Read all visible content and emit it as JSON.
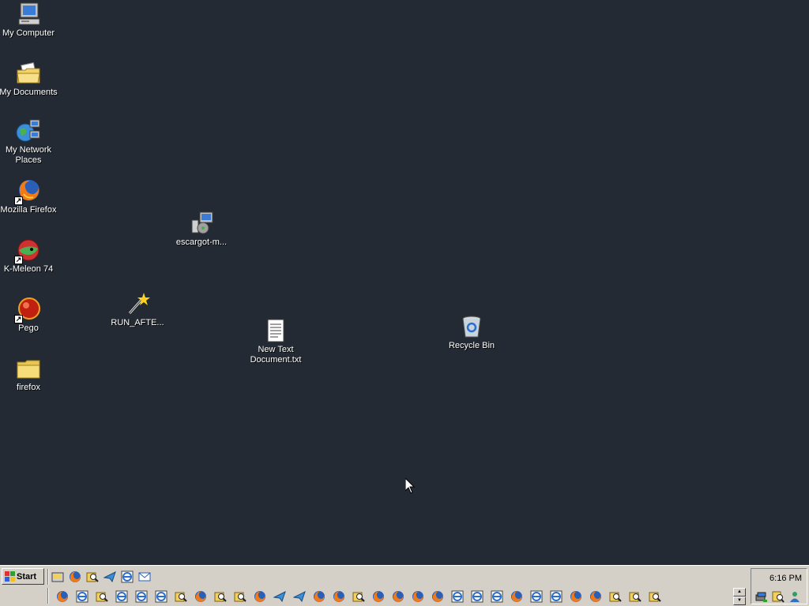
{
  "colors": {
    "desktop": "#232a33",
    "taskbar": "#d4d0c8",
    "label": "#ffffff"
  },
  "desktop": {
    "icons": [
      {
        "name": "my-computer",
        "label": "My Computer",
        "icon": "computer-icon"
      },
      {
        "name": "my-documents",
        "label": "My Documents",
        "icon": "documents-folder-icon"
      },
      {
        "name": "my-network-places",
        "label": "My Network Places",
        "icon": "network-icon"
      },
      {
        "name": "mozilla-firefox",
        "label": "Mozilla Firefox",
        "icon": "firefox-icon"
      },
      {
        "name": "k-meleon",
        "label": "K-Meleon 74",
        "icon": "k-meleon-icon"
      },
      {
        "name": "pego",
        "label": "Pego",
        "icon": "pego-icon"
      },
      {
        "name": "firefox-folder",
        "label": "firefox",
        "icon": "folder-icon"
      },
      {
        "name": "escargot",
        "label": "escargot-m...",
        "icon": "installer-icon"
      },
      {
        "name": "run-after",
        "label": "RUN_AFTE...",
        "icon": "magic-wand-icon"
      },
      {
        "name": "new-text-document",
        "label": "New Text Document.txt",
        "icon": "text-file-icon"
      },
      {
        "name": "recycle-bin",
        "label": "Recycle Bin",
        "icon": "recycle-bin-icon"
      }
    ]
  },
  "taskbar": {
    "start_label": "Start",
    "quick_launch": [
      "show-desktop-icon",
      "firefox-icon",
      "explorer-icon",
      "messenger-icon",
      "ie-icon",
      "outlook-icon"
    ],
    "tasks": [
      "firefox",
      "ie",
      "explorer",
      "ie",
      "ie",
      "ie",
      "explorer",
      "firefox",
      "explorer",
      "explorer",
      "firefox",
      "messenger",
      "messenger",
      "firefox",
      "firefox",
      "explorer",
      "firefox",
      "firefox",
      "firefox",
      "firefox",
      "ie",
      "ie",
      "ie",
      "firefox",
      "ie",
      "ie",
      "firefox",
      "firefox",
      "explorer",
      "explorer",
      "explorer"
    ],
    "clock": "6:16 PM",
    "tray_icons": [
      "network-tray-icon",
      "search-tray-icon",
      "user-tray-icon"
    ]
  }
}
